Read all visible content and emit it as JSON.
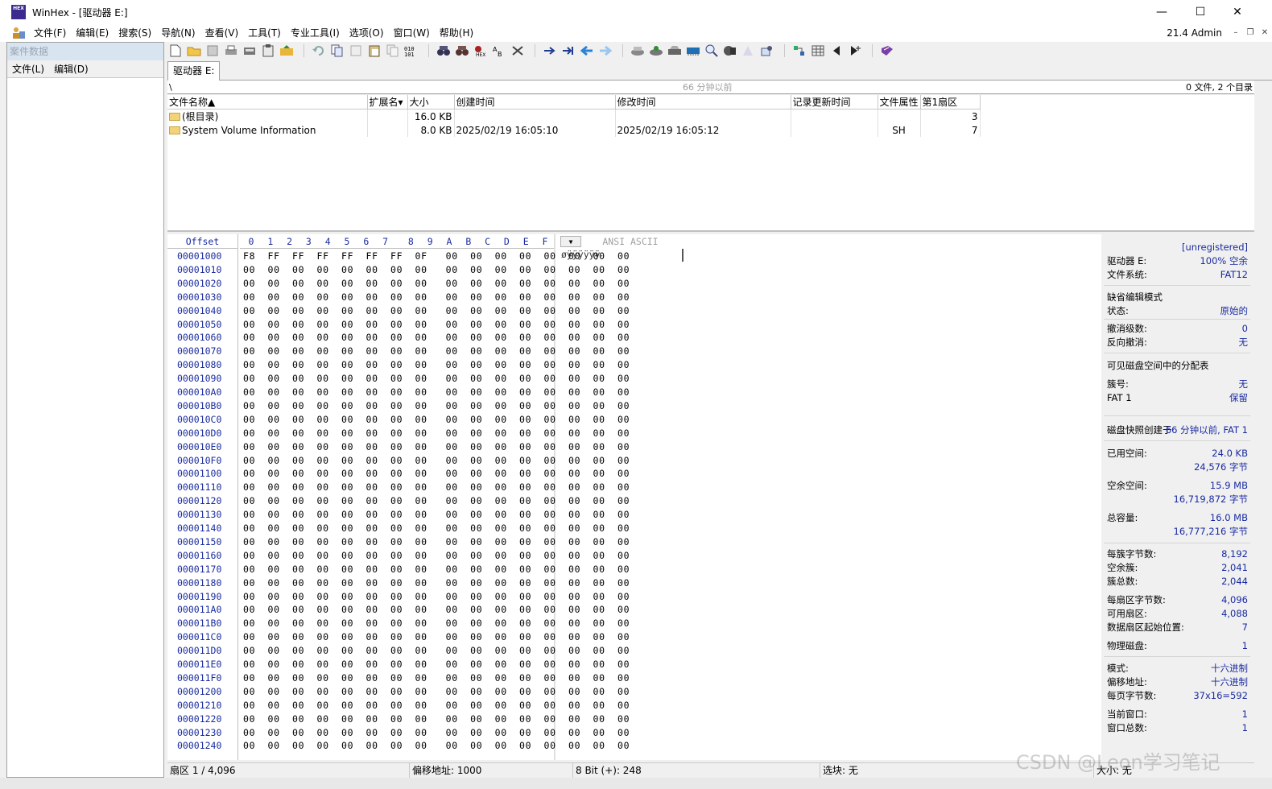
{
  "window": {
    "logo_text": "HEX",
    "title": "WinHex - [驱动器 E:]",
    "minimize": "—",
    "maximize": "☐",
    "close": "✕"
  },
  "menu": {
    "items": [
      "文件(F)",
      "编辑(E)",
      "搜索(S)",
      "导航(N)",
      "查看(V)",
      "工具(T)",
      "专业工具(I)",
      "选项(O)",
      "窗口(W)",
      "帮助(H)"
    ],
    "version": "21.4 Admin",
    "mdi_min": "–",
    "mdi_restore": "❐",
    "mdi_close": "✕"
  },
  "left_panel": {
    "header": "案件数据",
    "menu": [
      "文件(L)",
      "编辑(D)"
    ]
  },
  "tab": {
    "label": "驱动器 E:"
  },
  "path": {
    "current": "\\",
    "snapshot_age": "66 分钟以前",
    "counts": "0 文件, 2 个目录"
  },
  "file_table": {
    "headers": [
      "文件名称▲",
      "扩展名▾",
      "大小",
      "创建时间",
      "修改时间",
      "记录更新时间",
      "文件属性",
      "第1扇区"
    ],
    "rows": [
      {
        "name": "(根目录)",
        "ext": "",
        "size": "16.0 KB",
        "created": "",
        "modified": "",
        "record": "",
        "attr": "",
        "sector": "3"
      },
      {
        "name": "System Volume Information",
        "ext": "",
        "size": "8.0 KB",
        "created": "2025/02/19  16:05:10",
        "modified": "2025/02/19  16:05:12",
        "record": "",
        "attr": "SH",
        "sector": "7"
      }
    ]
  },
  "hex": {
    "offset_header": "Offset",
    "columns": [
      "0",
      "1",
      "2",
      "3",
      "4",
      "5",
      "6",
      "7",
      "8",
      "9",
      "A",
      "B",
      "C",
      "D",
      "E",
      "F"
    ],
    "ascii_header": "ANSI ASCII",
    "dropdown": "▼",
    "offsets": [
      "00001000",
      "00001010",
      "00001020",
      "00001030",
      "00001040",
      "00001050",
      "00001060",
      "00001070",
      "00001080",
      "00001090",
      "000010A0",
      "000010B0",
      "000010C0",
      "000010D0",
      "000010E0",
      "000010F0",
      "00001100",
      "00001110",
      "00001120",
      "00001130",
      "00001140",
      "00001150",
      "00001160",
      "00001170",
      "00001180",
      "00001190",
      "000011A0",
      "000011B0",
      "000011C0",
      "000011D0",
      "000011E0",
      "000011F0",
      "00001200",
      "00001210",
      "00001220",
      "00001230",
      "00001240"
    ],
    "first_row": "F8  FF  FF  FF  FF  FF  FF  0F   00  00  00  00  00  00  00  00",
    "zero_row": "00  00  00  00  00  00  00  00   00  00  00  00  00  00  00  00",
    "ascii_first": "øÿÿÿÿÿÿ"
  },
  "info": {
    "unregistered": "[unregistered]",
    "drive_label": "驱动器 E:",
    "drive_value": "100% 空余",
    "fs_label": "文件系统:",
    "fs_value": "FAT12",
    "edit_mode": "缺省编辑模式",
    "state_label": "状态:",
    "state_value": "原始的",
    "undo_label": "撤消级数:",
    "undo_value": "0",
    "redo_label": "反向撤消:",
    "redo_value": "无",
    "fat_visible": "可见磁盘空间中的分配表",
    "cluster_label": "簇号:",
    "cluster_value": "无",
    "fat1_label": "FAT 1",
    "fat1_value": "保留",
    "snapshot_label": "磁盘快照创建于",
    "snapshot_value": "66 分钟以前, FAT 1",
    "used_label": "已用空间:",
    "used_value": "24.0 KB",
    "used_bytes": "24,576 字节",
    "free_label": "空余空间:",
    "free_value": "15.9 MB",
    "free_bytes": "16,719,872 字节",
    "total_label": "总容量:",
    "total_value": "16.0 MB",
    "total_bytes": "16,777,216 字节",
    "bpc_label": "每簇字节数:",
    "bpc_value": "8,192",
    "freec_label": "空余簇:",
    "freec_value": "2,041",
    "totc_label": "簇总数:",
    "totc_value": "2,044",
    "bps_label": "每扇区字节数:",
    "bps_value": "4,096",
    "avail_label": "可用扇区:",
    "avail_value": "4,088",
    "datastart_label": "数据扇区起始位置:",
    "datastart_value": "7",
    "phys_label": "物理磁盘:",
    "phys_value": "1",
    "mode_label": "模式:",
    "mode_value": "十六进制",
    "offaddr_label": "偏移地址:",
    "offaddr_value": "十六进制",
    "bpp_label": "每页字节数:",
    "bpp_value": "37x16=592",
    "curwin_label": "当前窗口:",
    "curwin_value": "1",
    "totwin_label": "窗口总数:",
    "totwin_value": "1"
  },
  "status": {
    "sector": "扇区 1 / 4,096",
    "offset": "偏移地址: 1000",
    "bits": "8 Bit (+): 248",
    "block": "选块: 无",
    "size": "大小: 无"
  },
  "watermark": "CSDN @Leon学习笔记"
}
